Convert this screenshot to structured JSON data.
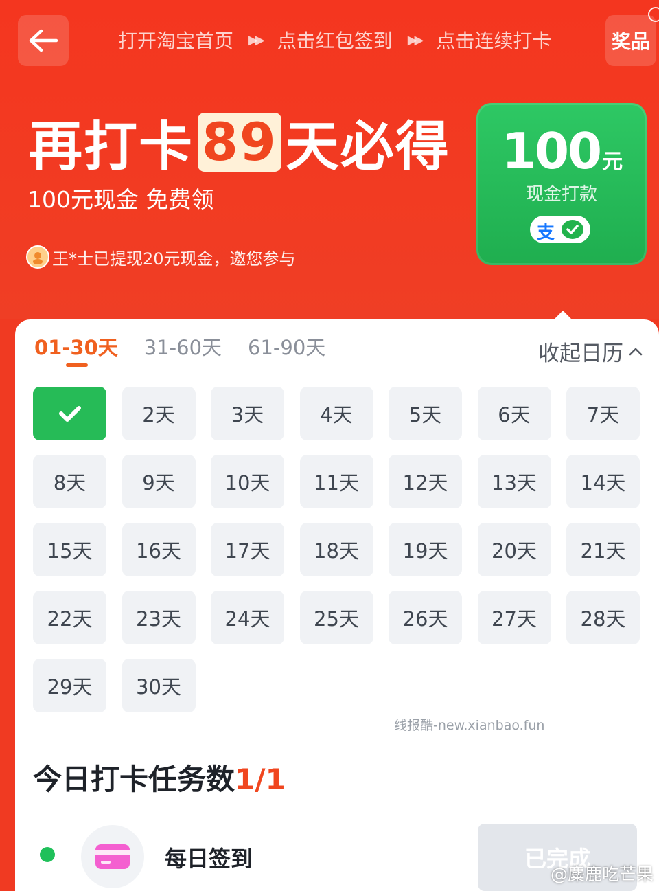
{
  "header": {
    "steps": [
      "打开淘宝首页",
      "点击红包签到",
      "点击连续打卡"
    ],
    "step_separator": "▶▶",
    "prize_label": "奖品",
    "headline_prefix": "再打卡",
    "headline_days": "89",
    "headline_suffix": "天必得",
    "subline": "100元现金 免费领",
    "notice": "王*士已提现20元现金，邀您参与"
  },
  "reward_card": {
    "amount": "100",
    "unit": "元",
    "label": "现金打款",
    "pay_ali": "支"
  },
  "calendar": {
    "tabs": [
      {
        "label": "01-30天",
        "active": true
      },
      {
        "label": "31-60天",
        "active": false
      },
      {
        "label": "61-90天",
        "active": false
      }
    ],
    "collapse_label": "收起日历",
    "days": [
      {
        "label": "",
        "done": true
      },
      {
        "label": "2天"
      },
      {
        "label": "3天"
      },
      {
        "label": "4天"
      },
      {
        "label": "5天"
      },
      {
        "label": "6天"
      },
      {
        "label": "7天"
      },
      {
        "label": "8天"
      },
      {
        "label": "9天"
      },
      {
        "label": "10天"
      },
      {
        "label": "11天"
      },
      {
        "label": "12天"
      },
      {
        "label": "13天"
      },
      {
        "label": "14天"
      },
      {
        "label": "15天"
      },
      {
        "label": "16天"
      },
      {
        "label": "17天"
      },
      {
        "label": "18天"
      },
      {
        "label": "19天"
      },
      {
        "label": "20天"
      },
      {
        "label": "21天"
      },
      {
        "label": "22天"
      },
      {
        "label": "23天"
      },
      {
        "label": "24天"
      },
      {
        "label": "25天"
      },
      {
        "label": "26天"
      },
      {
        "label": "27天"
      },
      {
        "label": "28天"
      },
      {
        "label": "29天"
      },
      {
        "label": "30天"
      }
    ]
  },
  "watermark": "线报酷-new.xianbao.fun",
  "tasks": {
    "title": "今日打卡任务数",
    "count": "1/1",
    "items": [
      {
        "name": "每日签到",
        "button": "已完成"
      }
    ]
  },
  "weibo_credit": "@麋鹿吃芒果",
  "colors": {
    "brand_red": "#f23b22",
    "accent_orange": "#f0601f",
    "success_green": "#26bb57"
  }
}
